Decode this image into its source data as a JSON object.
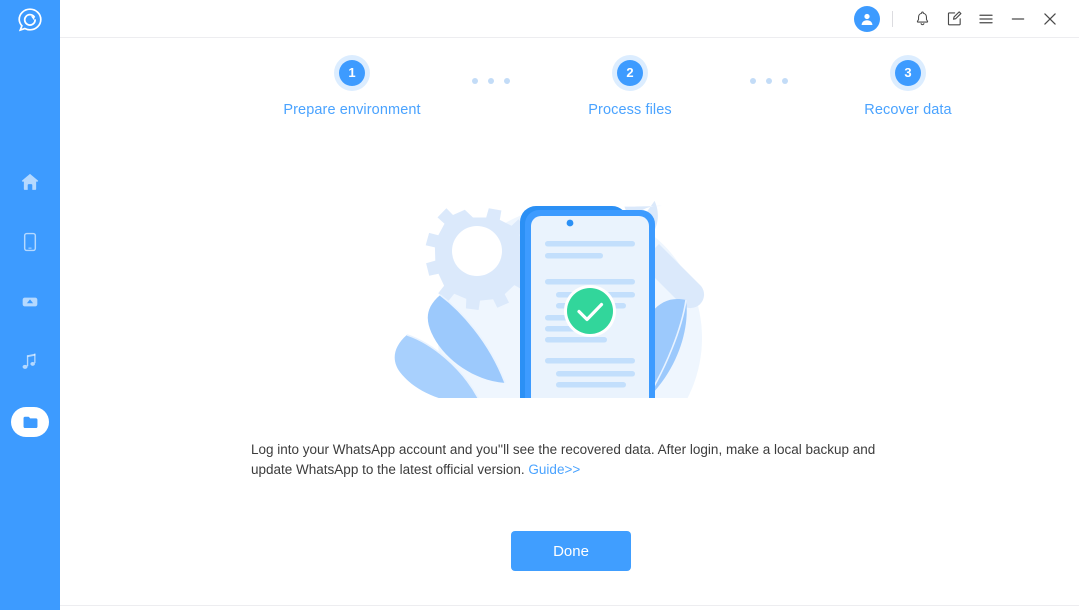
{
  "app": {
    "logo_icon": "whatsapp-recovery-logo-icon",
    "accent_color": "#409eff",
    "sidebar_color": "#3d9bff",
    "success_color": "#32d69b",
    "link_color": "#4aa3ff"
  },
  "sidebar": {
    "items": [
      {
        "icon": "home-icon",
        "name": "home",
        "active": false
      },
      {
        "icon": "device-icon",
        "name": "device",
        "active": false
      },
      {
        "icon": "cloud-icon",
        "name": "cloud",
        "active": false
      },
      {
        "icon": "music-icon",
        "name": "music",
        "active": false
      },
      {
        "icon": "folder-icon",
        "name": "folder",
        "active": true
      }
    ]
  },
  "titlebar": {
    "avatar_icon": "user-avatar-icon",
    "bell_icon": "bell-icon",
    "feedback_icon": "edit-note-icon",
    "menu_icon": "hamburger-menu-icon",
    "minimize_icon": "minimize-icon",
    "close_icon": "close-icon"
  },
  "stepper": {
    "steps": [
      {
        "number": "1",
        "label": "Prepare environment"
      },
      {
        "number": "2",
        "label": "Process files"
      },
      {
        "number": "3",
        "label": "Recover data"
      }
    ]
  },
  "illustration": {
    "name": "phone-recovery-success-illustration",
    "check_icon": "check-circle-icon",
    "gear_icon": "gear-icon",
    "wrench_icon": "wrench-icon"
  },
  "description": {
    "text": "Log into your WhatsApp account and you''ll see the recovered data. After login, make a local backup and update WhatsApp to the latest official version. ",
    "link_label": "Guide>>"
  },
  "actions": {
    "done_label": "Done"
  }
}
